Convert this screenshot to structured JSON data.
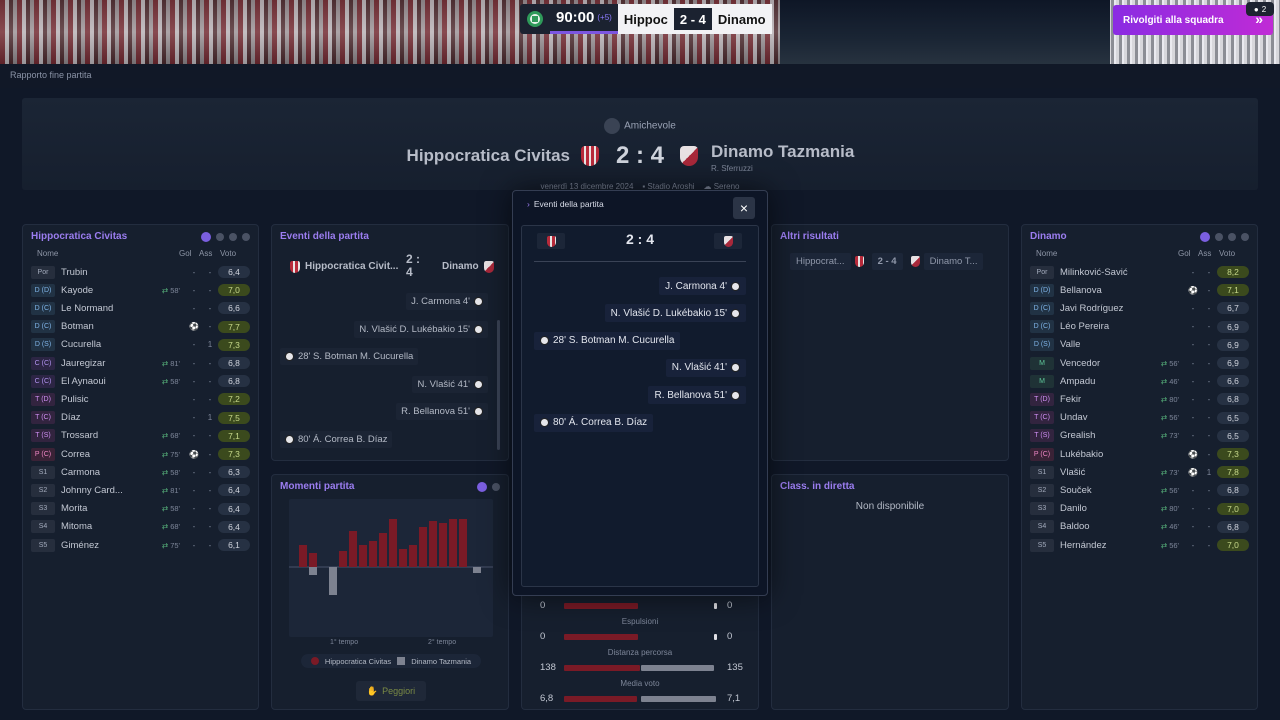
{
  "scorebug": {
    "time": "90:00",
    "added": "(+5)",
    "home": "Hippoc",
    "score": "2 - 4",
    "away": "Dinamo"
  },
  "back_button": "Rivolgiti alla squadra",
  "notifications": "2",
  "breadcrumb": "Rapporto fine partita",
  "match": {
    "competition": "Amichevole",
    "home": "Hippocratica Civitas",
    "away": "Dinamo Tazmania",
    "score": "2 : 4",
    "referee": "R. Sferruzzi",
    "date": "venerdì 13 dicembre 2024",
    "stadium": "Stadio Aroshi",
    "weather": "Sereno"
  },
  "home_panel": {
    "title": "Hippocratica Civitas",
    "headers": {
      "name": "Nome",
      "goals": "Gol",
      "assists": "Ass",
      "rating": "Voto"
    },
    "rows": [
      {
        "pos": "Por",
        "name": "Trubin",
        "sub": "",
        "g": "-",
        "a": "-",
        "v": "6,4"
      },
      {
        "pos": "D (D)",
        "name": "Kayode",
        "sub": "58'",
        "g": "-",
        "a": "-",
        "v": "7,0"
      },
      {
        "pos": "D (C)",
        "name": "Le Normand",
        "sub": "",
        "g": "-",
        "a": "-",
        "v": "6,6"
      },
      {
        "pos": "D (C)",
        "name": "Botman",
        "sub": "",
        "g": "",
        "a": "-",
        "v": "7,7"
      },
      {
        "pos": "D (S)",
        "name": "Cucurella",
        "sub": "",
        "g": "-",
        "a": "1",
        "v": "7,3"
      },
      {
        "pos": "C (C)",
        "name": "Jauregizar",
        "sub": "81'",
        "g": "-",
        "a": "-",
        "v": "6,8"
      },
      {
        "pos": "C (C)",
        "name": "El Aynaoui",
        "sub": "58'",
        "g": "-",
        "a": "-",
        "v": "6,8"
      },
      {
        "pos": "T (D)",
        "name": "Pulisic",
        "sub": "",
        "g": "-",
        "a": "-",
        "v": "7,2"
      },
      {
        "pos": "T (C)",
        "name": "Díaz",
        "sub": "",
        "g": "-",
        "a": "1",
        "v": "7,5"
      },
      {
        "pos": "T (S)",
        "name": "Trossard",
        "sub": "68'",
        "g": "-",
        "a": "-",
        "v": "7,1"
      },
      {
        "pos": "P (C)",
        "name": "Correa",
        "sub": "75'",
        "g": "",
        "a": "-",
        "v": "7,3"
      },
      {
        "pos": "S1",
        "name": "Carmona",
        "sub": "58'",
        "g": "-",
        "a": "-",
        "v": "6,3"
      },
      {
        "pos": "S2",
        "name": "Johnny Card...",
        "sub": "81'",
        "g": "-",
        "a": "-",
        "v": "6,4"
      },
      {
        "pos": "S3",
        "name": "Morita",
        "sub": "58'",
        "g": "-",
        "a": "-",
        "v": "6,4"
      },
      {
        "pos": "S4",
        "name": "Mitoma",
        "sub": "68'",
        "g": "-",
        "a": "-",
        "v": "6,4"
      },
      {
        "pos": "S5",
        "name": "Giménez",
        "sub": "75'",
        "g": "-",
        "a": "-",
        "v": "6,1"
      }
    ]
  },
  "away_panel": {
    "title": "Dinamo",
    "headers": {
      "name": "Nome",
      "goals": "Gol",
      "assists": "Ass",
      "rating": "Voto"
    },
    "rows": [
      {
        "pos": "Por",
        "name": "Milinković-Savić",
        "sub": "",
        "g": "-",
        "a": "-",
        "v": "8,2"
      },
      {
        "pos": "D (D)",
        "name": "Bellanova",
        "sub": "",
        "g": "",
        "a": "-",
        "v": "7,1"
      },
      {
        "pos": "D (C)",
        "name": "Javi Rodríguez",
        "sub": "",
        "g": "-",
        "a": "-",
        "v": "6,7"
      },
      {
        "pos": "D (C)",
        "name": "Léo Pereira",
        "sub": "",
        "g": "-",
        "a": "-",
        "v": "6,9"
      },
      {
        "pos": "D (S)",
        "name": "Valle",
        "sub": "",
        "g": "-",
        "a": "-",
        "v": "6,9"
      },
      {
        "pos": "M",
        "name": "Vencedor",
        "sub": "56'",
        "g": "-",
        "a": "-",
        "v": "6,9"
      },
      {
        "pos": "M",
        "name": "Ampadu",
        "sub": "46'",
        "g": "-",
        "a": "-",
        "v": "6,6"
      },
      {
        "pos": "T (D)",
        "name": "Fekir",
        "sub": "80'",
        "g": "-",
        "a": "-",
        "v": "6,8"
      },
      {
        "pos": "T (C)",
        "name": "Undav",
        "sub": "56'",
        "g": "-",
        "a": "-",
        "v": "6,5"
      },
      {
        "pos": "T (S)",
        "name": "Grealish",
        "sub": "73'",
        "g": "-",
        "a": "-",
        "v": "6,5"
      },
      {
        "pos": "P (C)",
        "name": "Lukébakio",
        "sub": "",
        "g": "",
        "a": "-",
        "v": "7,3"
      },
      {
        "pos": "S1",
        "name": "Vlašić",
        "sub": "73'",
        "g": "",
        "a": "1",
        "v": "7,8"
      },
      {
        "pos": "S2",
        "name": "Souček",
        "sub": "56'",
        "g": "-",
        "a": "-",
        "v": "6,8"
      },
      {
        "pos": "S3",
        "name": "Danilo",
        "sub": "80'",
        "g": "-",
        "a": "-",
        "v": "7,0"
      },
      {
        "pos": "S4",
        "name": "Baldoo",
        "sub": "46'",
        "g": "-",
        "a": "-",
        "v": "6,8"
      },
      {
        "pos": "S5",
        "name": "Hernández",
        "sub": "56'",
        "g": "-",
        "a": "-",
        "v": "7,0"
      }
    ]
  },
  "events_panel": {
    "title": "Eventi della partita",
    "home": "Hippocratica Civit...",
    "score": "2 : 4",
    "away": "Dinamo",
    "events": [
      {
        "side": "away",
        "text": "J. Carmona 4'"
      },
      {
        "side": "away",
        "text": "N. Vlašić D. Lukébakio 15'"
      },
      {
        "side": "home",
        "text": "28' S. Botman M. Cucurella"
      },
      {
        "side": "away",
        "text": "N. Vlašić 41'"
      },
      {
        "side": "away",
        "text": "R. Bellanova 51'"
      },
      {
        "side": "home",
        "text": "80' Á. Correa B. Díaz"
      }
    ]
  },
  "moments_panel": {
    "title": "Momenti partita",
    "first_half": "1° tempo",
    "second_half": "2° tempo",
    "legend_home": "Hippocratica Civitas",
    "legend_away": "Dinamo Tazmania",
    "button": "Peggiori"
  },
  "other_results": {
    "title": "Altri risultati",
    "home": "Hippocrat...",
    "score": "2 - 4",
    "away": "Dinamo T..."
  },
  "live_table": {
    "title": "Class. in diretta",
    "text": "Non disponibile"
  },
  "stats": [
    {
      "label": "",
      "home": "0",
      "away": "0"
    },
    {
      "label": "Espulsioni",
      "home": "0",
      "away": "0"
    },
    {
      "label": "Distanza percorsa",
      "home": "138",
      "away": "135"
    },
    {
      "label": "Media voto",
      "home": "6,8",
      "away": "7,1"
    }
  ],
  "modal": {
    "title": "Eventi della partita",
    "score": "2 : 4",
    "close": "×",
    "events": [
      {
        "side": "away",
        "text": "J. Carmona 4'"
      },
      {
        "side": "away",
        "text": "N. Vlašić D. Lukébakio 15'"
      },
      {
        "side": "home",
        "text": "28' S. Botman M. Cucurella"
      },
      {
        "side": "away",
        "text": "N. Vlašić 41'"
      },
      {
        "side": "away",
        "text": "R. Bellanova 51'"
      },
      {
        "side": "home",
        "text": "80' Á. Correa B. Díaz"
      }
    ]
  }
}
